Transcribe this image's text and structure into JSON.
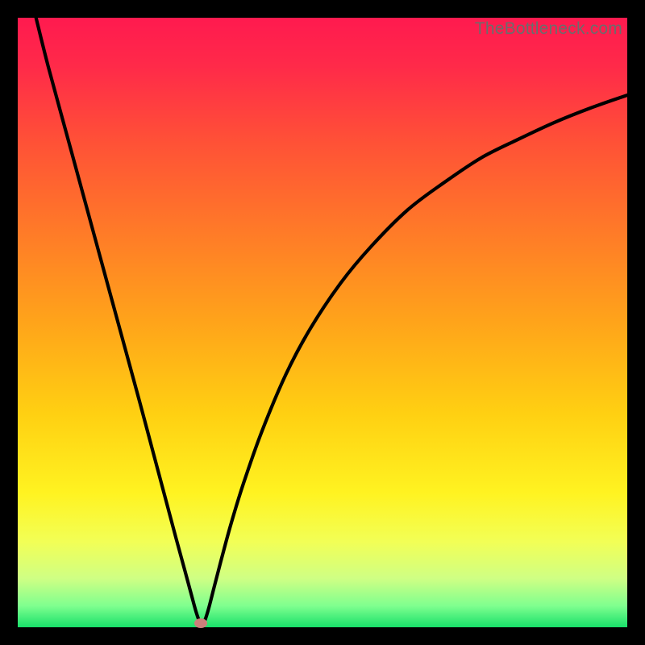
{
  "attribution": "TheBottleneck.com",
  "gradient": {
    "stops": [
      {
        "offset": 0.0,
        "color": "#ff1a4f"
      },
      {
        "offset": 0.08,
        "color": "#ff2a49"
      },
      {
        "offset": 0.2,
        "color": "#ff5037"
      },
      {
        "offset": 0.35,
        "color": "#ff7a28"
      },
      {
        "offset": 0.5,
        "color": "#ffa41a"
      },
      {
        "offset": 0.65,
        "color": "#ffd012"
      },
      {
        "offset": 0.78,
        "color": "#fff321"
      },
      {
        "offset": 0.86,
        "color": "#f2ff56"
      },
      {
        "offset": 0.92,
        "color": "#cfff84"
      },
      {
        "offset": 0.965,
        "color": "#7fff8f"
      },
      {
        "offset": 1.0,
        "color": "#18e06a"
      }
    ]
  },
  "chart_data": {
    "type": "line",
    "title": "",
    "xlabel": "",
    "ylabel": "",
    "xlim": [
      0,
      100
    ],
    "ylim": [
      0,
      100
    ],
    "grid": false,
    "legend": false,
    "series": [
      {
        "name": "curve",
        "x": [
          3,
          5,
          8,
          11,
          14,
          17,
          20,
          22,
          24,
          26,
          27.5,
          28.5,
          29.3,
          30,
          30.6,
          31.3,
          32.2,
          33.5,
          35,
          37,
          40,
          44,
          48,
          53,
          58,
          64,
          70,
          76,
          82,
          88,
          94,
          100
        ],
        "y": [
          100,
          92,
          81,
          70,
          59,
          48,
          37,
          29.5,
          22,
          14.5,
          9,
          5.3,
          2.4,
          0.6,
          0.9,
          3,
          6.5,
          11.5,
          17,
          23.5,
          32,
          41.5,
          49,
          56.5,
          62.5,
          68.5,
          73,
          77,
          80,
          82.8,
          85.2,
          87.3
        ]
      }
    ],
    "markers": [
      {
        "name": "min-point",
        "x": 30,
        "y": 0.6,
        "color": "#cc7f7b"
      }
    ]
  }
}
